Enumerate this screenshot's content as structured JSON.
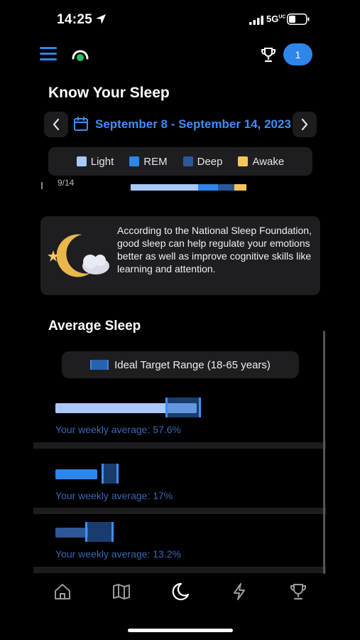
{
  "status": {
    "time": "14:25",
    "network": "5G",
    "network_sup": "UC"
  },
  "header": {
    "badge_count": "1"
  },
  "page": {
    "title": "Know Your Sleep",
    "date_range": "September 8 - September 14, 2023"
  },
  "legend": [
    {
      "label": "Light",
      "color": "#a9c9f8"
    },
    {
      "label": "REM",
      "color": "#2e86ea"
    },
    {
      "label": "Deep",
      "color": "#2d5898"
    },
    {
      "label": "Awake",
      "color": "#f7c45a"
    }
  ],
  "partial_row": {
    "date": "9/14",
    "segments": [
      {
        "stage": "Light",
        "fraction": 0.57
      },
      {
        "stage": "REM",
        "fraction": 0.17
      },
      {
        "stage": "Deep",
        "fraction": 0.14
      },
      {
        "stage": "Awake",
        "fraction": 0.1
      }
    ]
  },
  "info": {
    "text": "According to the National Sleep Foundation, good sleep can help regulate your emotions better as well as improve cognitive skills like learning and attention."
  },
  "average": {
    "title": "Average Sleep",
    "ideal_label": "Ideal Target Range (18-65 years)",
    "items": [
      {
        "stage": "Light",
        "caption": "Your weekly average: 57.6%",
        "value": 57.6,
        "color": "#a9c9f8"
      },
      {
        "stage": "REM",
        "caption": "Your weekly average: 17%",
        "value": 17,
        "color": "#2e86ea"
      },
      {
        "stage": "Deep",
        "caption": "Your weekly average: 13.2%",
        "value": 13.2,
        "color": "#2d5898"
      }
    ]
  },
  "tabs": [
    {
      "name": "home",
      "icon": "home-icon",
      "active": false
    },
    {
      "name": "map",
      "icon": "map-icon",
      "active": false
    },
    {
      "name": "sleep",
      "icon": "moon-icon",
      "active": true
    },
    {
      "name": "energy",
      "icon": "lightning-icon",
      "active": false
    },
    {
      "name": "trophy",
      "icon": "trophy-icon",
      "active": false
    }
  ]
}
